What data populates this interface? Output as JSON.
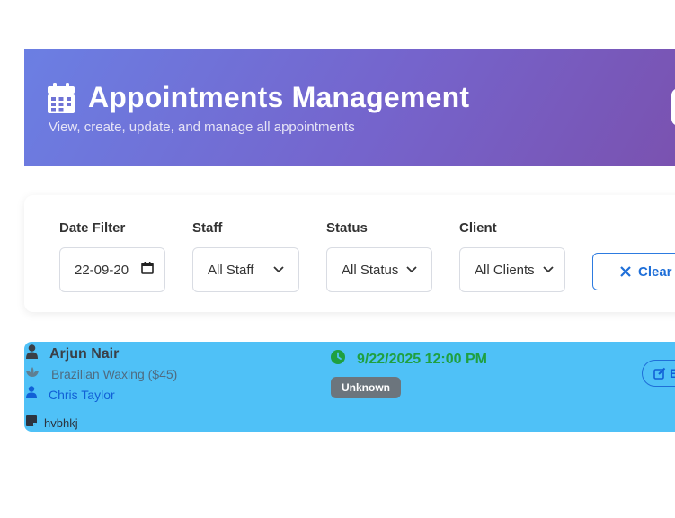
{
  "header": {
    "title": "Appointments Management",
    "subtitle": "View, create, update, and manage all appointments"
  },
  "filters": {
    "date": {
      "label": "Date Filter",
      "value": "22-09-20"
    },
    "staff": {
      "label": "Staff",
      "value": "All Staff"
    },
    "status": {
      "label": "Status",
      "value": "All Status"
    },
    "client": {
      "label": "Client",
      "value": "All Clients"
    },
    "clear_label": "Clear"
  },
  "appointments": [
    {
      "client": "Arjun Nair",
      "service": "Brazilian Waxing ($45)",
      "staff": "Chris Taylor",
      "note": "hvbhkj",
      "datetime": "9/22/2025 12:00 PM",
      "status": "Unknown",
      "edit_label": "E"
    }
  ],
  "colors": {
    "header_gradient_start": "#6b7fe3",
    "header_gradient_end": "#7a52b0",
    "card_background": "#4fc1f7",
    "datetime": "#1fa040",
    "status_unknown": "#6c757d",
    "link": "#1160d6"
  }
}
